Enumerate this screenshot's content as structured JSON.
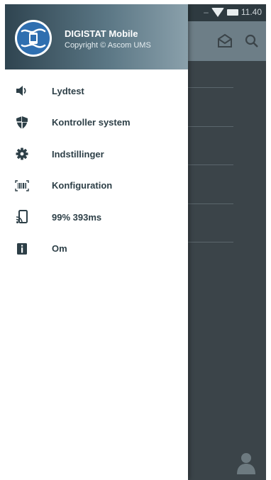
{
  "status_bar": {
    "time": "11.40",
    "dash": "–"
  },
  "drawer": {
    "app_name": "DIGISTAT Mobile",
    "copyright": "Copyright © Ascom UMS",
    "items": [
      {
        "label": "Lydtest",
        "icon": "speaker-icon"
      },
      {
        "label": "Kontroller system",
        "icon": "shield-icon"
      },
      {
        "label": "Indstillinger",
        "icon": "gear-icon"
      },
      {
        "label": "Konfiguration",
        "icon": "barcode-icon"
      },
      {
        "label": "99% 393ms",
        "icon": "cast-icon"
      },
      {
        "label": "Om",
        "icon": "info-icon"
      }
    ]
  },
  "colors": {
    "drawer_header_start": "#2f4450",
    "drawer_header_end": "#8aa0ab",
    "icon": "#2d3f47",
    "background_panel": "#3b4449",
    "app_bar": "#6d7e87"
  }
}
